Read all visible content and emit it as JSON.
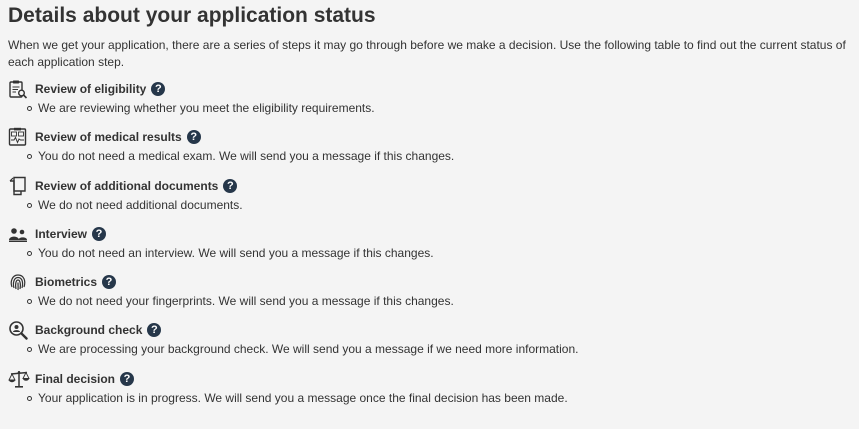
{
  "page": {
    "title": "Details about your application status",
    "intro": "When we get your application, there are a series of steps it may go through before we make a decision. Use the following table to find out the current status of each application step."
  },
  "steps": [
    {
      "title": "Review of eligibility",
      "icon": "clipboard-search-icon",
      "description": "We are reviewing whether you meet the eligibility requirements."
    },
    {
      "title": "Review of medical results",
      "icon": "medical-chart-icon",
      "description": "You do not need a medical exam. We will send you a message if this changes."
    },
    {
      "title": "Review of additional documents",
      "icon": "documents-icon",
      "description": "We do not need additional documents."
    },
    {
      "title": "Interview",
      "icon": "people-icon",
      "description": "You do not need an interview. We will send you a message if this changes."
    },
    {
      "title": "Biometrics",
      "icon": "fingerprint-icon",
      "description": "We do not need your fingerprints. We will send you a message if this changes."
    },
    {
      "title": "Background check",
      "icon": "magnifier-person-icon",
      "description": "We are processing your background check. We will send you a message if we need more information."
    },
    {
      "title": "Final decision",
      "icon": "scales-icon",
      "description": "Your application is in progress. We will send you a message once the final decision has been made."
    }
  ],
  "help_glyph": "?",
  "colors": {
    "help_badge": "#26374a",
    "text": "#333333",
    "background": "#f4f4f4"
  }
}
